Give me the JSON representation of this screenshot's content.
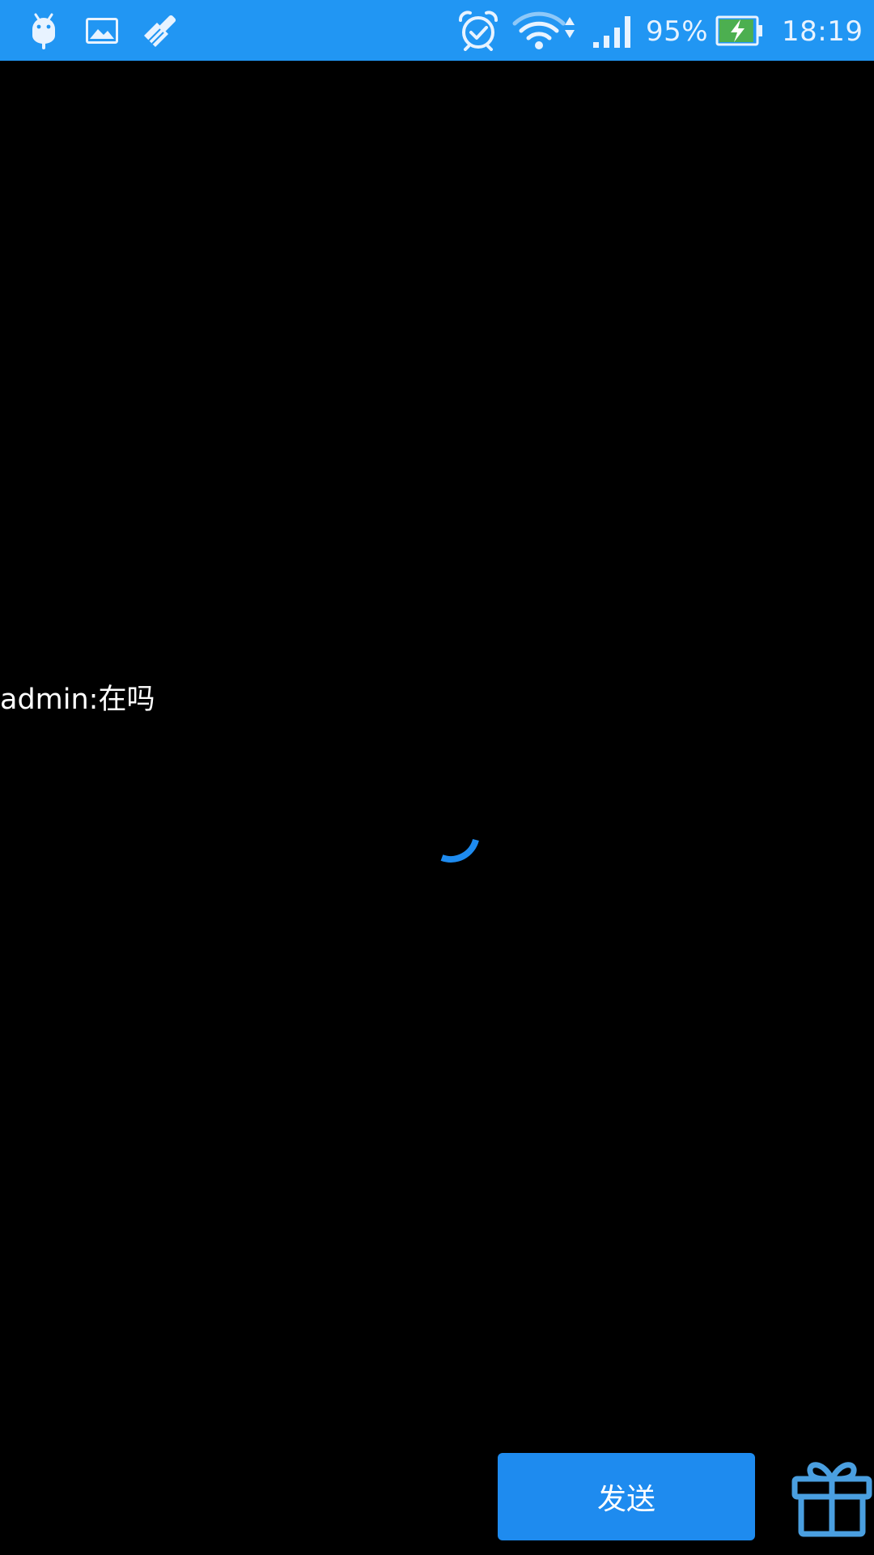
{
  "status_bar": {
    "background": "#2196F3",
    "left_icons": [
      "android-debug-icon",
      "image-notification-icon",
      "cleaner-brush-icon"
    ],
    "right_icons": [
      "alarm-clock-icon",
      "wifi-data-activity-icon",
      "cellular-signal-icon",
      "battery-charging-icon"
    ],
    "battery_percent": "95%",
    "battery_level": 95,
    "time": "18:19"
  },
  "chat": {
    "messages": [
      {
        "sender": "admin",
        "separator": ":",
        "text": "在吗"
      }
    ]
  },
  "loading": {
    "icon": "loading-spinner-icon",
    "color": "#1E8BEF"
  },
  "bottom_bar": {
    "send_label": "发送",
    "send_color": "#1E8BEF",
    "gift_icon": "gift-icon",
    "gift_color": "#4A9FE0"
  }
}
